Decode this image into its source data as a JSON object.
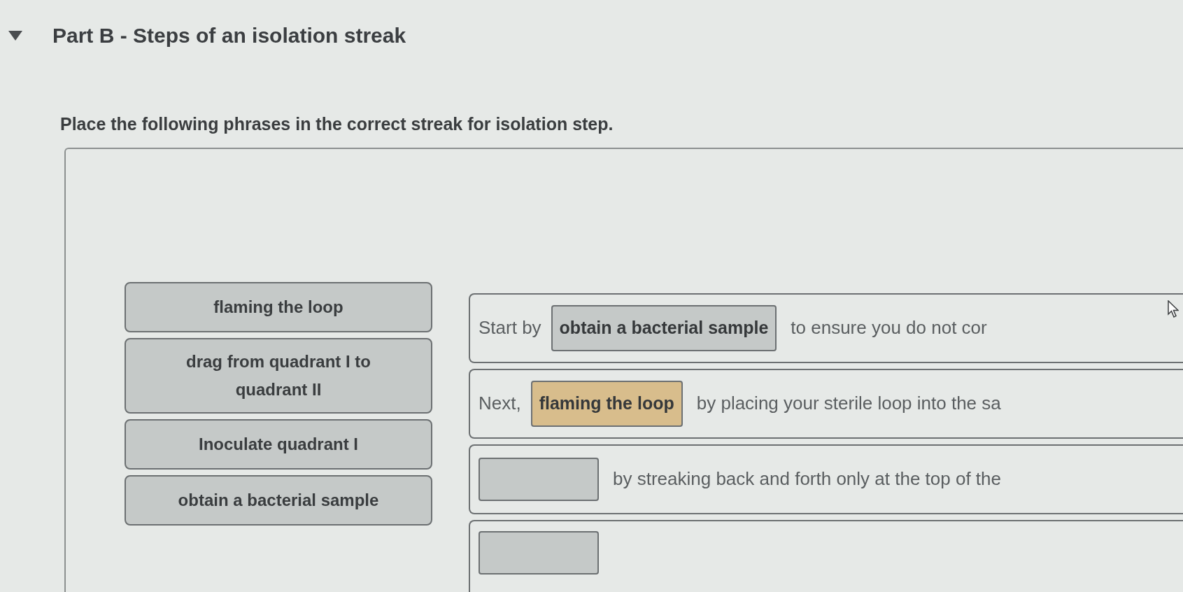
{
  "part": {
    "title": "Part B - Steps of an isolation streak",
    "expanded": true
  },
  "instruction": "Place the following phrases in the correct streak for isolation step.",
  "phrase_bank": [
    {
      "label": "flaming the loop"
    },
    {
      "label": "drag from quadrant I to quadrant II"
    },
    {
      "label": "Inoculate quadrant I"
    },
    {
      "label": "obtain a bacterial sample"
    }
  ],
  "steps": [
    {
      "prefix": "Start by",
      "answer": "obtain a bacterial sample",
      "highlighted": false,
      "suffix": "to ensure you do not cor"
    },
    {
      "prefix": "Next,",
      "answer": "flaming the loop",
      "highlighted": true,
      "suffix": "by placing your sterile loop into the sa"
    },
    {
      "highlighted": false,
      "suffix": "by streaking back and forth only at the top of the"
    },
    {
      "highlighted": false
    }
  ]
}
